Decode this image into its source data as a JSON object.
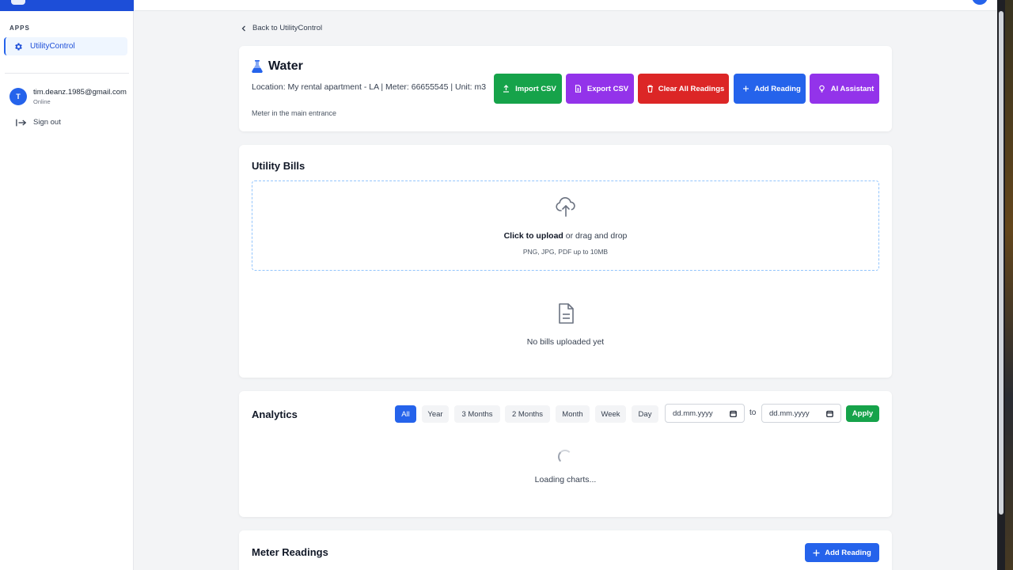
{
  "sidebar": {
    "section_label": "APPS",
    "items": [
      {
        "label": "UtilityControl",
        "icon": "gear-icon",
        "active": true
      }
    ],
    "user": {
      "initial": "T",
      "email": "tim.deanz.1985@gmail.com",
      "status": "Online"
    },
    "sign_out_label": "Sign out"
  },
  "back_link": {
    "label": "Back to UtilityControl"
  },
  "header": {
    "title": "Water",
    "icon": "flask-icon",
    "meta_line": "Location: My rental apartment - LA | Meter: 66655545 | Unit: m3",
    "note": "Meter in the main entrance",
    "buttons": {
      "import": {
        "label": "Import CSV",
        "icon": "upload-icon",
        "color": "#16a34a"
      },
      "export": {
        "label": "Export CSV",
        "icon": "file-icon",
        "color": "#9333ea"
      },
      "clear": {
        "label": "Clear All Readings",
        "icon": "trash-icon",
        "color": "#dc2626"
      },
      "add": {
        "label": "Add Reading",
        "icon": "plus-icon",
        "color": "#2563eb"
      },
      "ai": {
        "label": "AI Assistant",
        "icon": "lightbulb-icon",
        "color": "#9333ea"
      }
    }
  },
  "bills": {
    "title": "Utility Bills",
    "upload_strong": "Click to upload",
    "upload_rest": " or drag and drop",
    "upload_hint": "PNG, JPG, PDF up to 10MB",
    "empty_text": "No bills uploaded yet"
  },
  "analytics": {
    "title": "Analytics",
    "ranges": [
      "All",
      "Year",
      "3 Months",
      "2 Months",
      "Month",
      "Week",
      "Day"
    ],
    "active_range": "All",
    "date_from_placeholder": "dd.mm.yyyy",
    "to_label": "to",
    "date_to_placeholder": "dd.mm.yyyy",
    "apply_label": "Apply",
    "loading_text": "Loading charts..."
  },
  "readings": {
    "title": "Meter Readings",
    "add_label": "Add Reading"
  },
  "colors": {
    "primary": "#2563eb",
    "success": "#16a34a",
    "danger": "#dc2626",
    "purple": "#9333ea"
  }
}
